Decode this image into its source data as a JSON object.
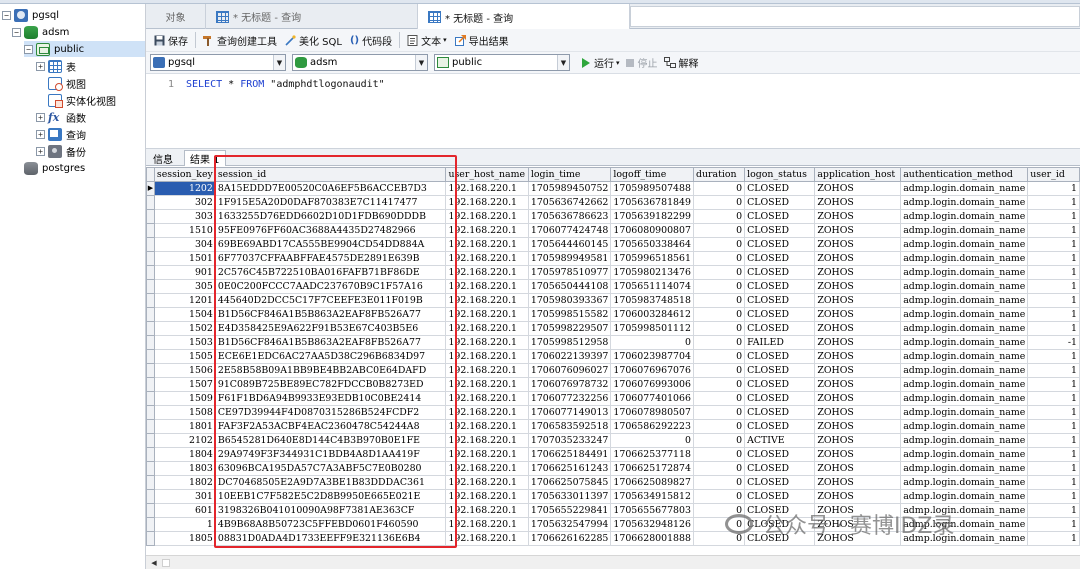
{
  "tree": {
    "connection": "pgsql",
    "database": "adsm",
    "schema": "public",
    "items": [
      "表",
      "视图",
      "实体化视图",
      "函数",
      "查询",
      "备份"
    ],
    "other_database": "postgres"
  },
  "tabs": {
    "objects": "对象",
    "tab1": "* 无标题 - 查询",
    "tab2": "* 无标题 - 查询"
  },
  "toolbar": {
    "save": "保存",
    "query_builder": "查询创建工具",
    "beautify": "美化 SQL",
    "code_snippet": "代码段",
    "text": "文本",
    "export": "导出结果"
  },
  "conn": {
    "connection": "pgsql",
    "database": "adsm",
    "schema": "public",
    "run": "运行",
    "stop": "停止",
    "explain": "解释"
  },
  "editor": {
    "line": "1",
    "kw_select": "SELECT",
    "star": " * ",
    "kw_from": "FROM",
    "table": " \"admphdtlogonaudit\""
  },
  "result_tabs": {
    "info": "信息",
    "result": "结果 1"
  },
  "grid": {
    "columns": [
      "session_key",
      "session_id",
      "user_host_name",
      "login_time",
      "logoff_time",
      "duration",
      "logon_status",
      "application_host",
      "authentication_method",
      "user_id"
    ],
    "rows": [
      [
        "1202",
        "8A15EDDD7E00520C0A6EF5B6ACCEB7D3",
        "192.168.220.1",
        "1705989450752",
        "1705989507488",
        "0",
        "CLOSED",
        "ZOHOS",
        "admp.login.domain_name",
        "1"
      ],
      [
        "302",
        "1F915E5A20D0DAF870383E7C11417477",
        "192.168.220.1",
        "1705636742662",
        "1705636781849",
        "0",
        "CLOSED",
        "ZOHOS",
        "admp.login.domain_name",
        "1"
      ],
      [
        "303",
        "1633255D76EDD6602D10D1FDB690DDDB",
        "192.168.220.1",
        "1705636786623",
        "1705639182299",
        "0",
        "CLOSED",
        "ZOHOS",
        "admp.login.domain_name",
        "1"
      ],
      [
        "1510",
        "95FE0976FF60AC3688A4435D27482966",
        "192.168.220.1",
        "1706077424748",
        "1706080900807",
        "0",
        "CLOSED",
        "ZOHOS",
        "admp.login.domain_name",
        "1"
      ],
      [
        "304",
        "69BE69ABD17CA555BE9904CD54DD884A",
        "192.168.220.1",
        "1705644460145",
        "1705650338464",
        "0",
        "CLOSED",
        "ZOHOS",
        "admp.login.domain_name",
        "1"
      ],
      [
        "1501",
        "6F77037CFFAABFFAE4575DE2891E639B",
        "192.168.220.1",
        "1705989949581",
        "1705996518561",
        "0",
        "CLOSED",
        "ZOHOS",
        "admp.login.domain_name",
        "1"
      ],
      [
        "901",
        "2C576C45B722510BA016FAFB71BF86DE",
        "192.168.220.1",
        "1705978510977",
        "1705980213476",
        "0",
        "CLOSED",
        "ZOHOS",
        "admp.login.domain_name",
        "1"
      ],
      [
        "305",
        "0E0C200FCCC7AADC237670B9C1F57A16",
        "192.168.220.1",
        "1705650444108",
        "1705651114074",
        "0",
        "CLOSED",
        "ZOHOS",
        "admp.login.domain_name",
        "1"
      ],
      [
        "1201",
        "445640D2DCC5C17F7CEEFE3E011F019B",
        "192.168.220.1",
        "1705980393367",
        "1705983748518",
        "0",
        "CLOSED",
        "ZOHOS",
        "admp.login.domain_name",
        "1"
      ],
      [
        "1504",
        "B1D56CF846A1B5B863A2EAF8FB526A77",
        "192.168.220.1",
        "1705998515582",
        "1706003284612",
        "0",
        "CLOSED",
        "ZOHOS",
        "admp.login.domain_name",
        "1"
      ],
      [
        "1502",
        "E4D358425E9A622F91B53E67C403B5E6",
        "192.168.220.1",
        "1705998229507",
        "1705998501112",
        "0",
        "CLOSED",
        "ZOHOS",
        "admp.login.domain_name",
        "1"
      ],
      [
        "1503",
        "B1D56CF846A1B5B863A2EAF8FB526A77",
        "192.168.220.1",
        "1705998512958",
        "0",
        "0",
        "FAILED",
        "ZOHOS",
        "admp.login.domain_name",
        "-1"
      ],
      [
        "1505",
        "ECE6E1EDC6AC27AA5D38C296B6834D97",
        "192.168.220.1",
        "1706022139397",
        "1706023987704",
        "0",
        "CLOSED",
        "ZOHOS",
        "admp.login.domain_name",
        "1"
      ],
      [
        "1506",
        "2E58B58B09A1BB9BE4BB2ABC0E64DAFD",
        "192.168.220.1",
        "1706076096027",
        "1706076967076",
        "0",
        "CLOSED",
        "ZOHOS",
        "admp.login.domain_name",
        "1"
      ],
      [
        "1507",
        "91C089B725BE89EC782FDCCB0B8273ED",
        "192.168.220.1",
        "1706076978732",
        "1706076993006",
        "0",
        "CLOSED",
        "ZOHOS",
        "admp.login.domain_name",
        "1"
      ],
      [
        "1509",
        "F61F1BD6A94B9933E93EDB10C0BE2414",
        "192.168.220.1",
        "1706077232256",
        "1706077401066",
        "0",
        "CLOSED",
        "ZOHOS",
        "admp.login.domain_name",
        "1"
      ],
      [
        "1508",
        "CE97D39944F4D0870315286B524FCDF2",
        "192.168.220.1",
        "1706077149013",
        "1706078980507",
        "0",
        "CLOSED",
        "ZOHOS",
        "admp.login.domain_name",
        "1"
      ],
      [
        "1801",
        "FAF3F2A53ACBF4EAC2360478C54244A8",
        "192.168.220.1",
        "1706583592518",
        "1706586292223",
        "0",
        "CLOSED",
        "ZOHOS",
        "admp.login.domain_name",
        "1"
      ],
      [
        "2102",
        "B6545281D640E8D144C4B3B970B0E1FE",
        "192.168.220.1",
        "1707035233247",
        "0",
        "0",
        "ACTIVE",
        "ZOHOS",
        "admp.login.domain_name",
        "1"
      ],
      [
        "1804",
        "29A9749F3F344931C1BDB4A8D1AA419F",
        "192.168.220.1",
        "1706625184491",
        "1706625377118",
        "0",
        "CLOSED",
        "ZOHOS",
        "admp.login.domain_name",
        "1"
      ],
      [
        "1803",
        "63096BCA195DA57C7A3ABF5C7E0B0280",
        "192.168.220.1",
        "1706625161243",
        "1706625172874",
        "0",
        "CLOSED",
        "ZOHOS",
        "admp.login.domain_name",
        "1"
      ],
      [
        "1802",
        "DC70468505E2A9D7A3BE1B83DDDAC361",
        "192.168.220.1",
        "1706625075845",
        "1706625089827",
        "0",
        "CLOSED",
        "ZOHOS",
        "admp.login.domain_name",
        "1"
      ],
      [
        "301",
        "10EEB1C7F582E5C2D8B9950E665E021E",
        "192.168.220.1",
        "1705633011397",
        "1705634915812",
        "0",
        "CLOSED",
        "ZOHOS",
        "admp.login.domain_name",
        "1"
      ],
      [
        "601",
        "3198326B041010090A98F7381AE363CF",
        "192.168.220.1",
        "1705655229841",
        "1705655677803",
        "0",
        "CLOSED",
        "ZOHOS",
        "admp.login.domain_name",
        "1"
      ],
      [
        "1",
        "4B9B68A8B50723C5FFEBD0601F460590",
        "192.168.220.1",
        "1705632547994",
        "1705632948126",
        "0",
        "CLOSED",
        "ZOHOS",
        "admp.login.domain_name",
        "1"
      ],
      [
        "1805",
        "08831D0ADA4D1733EEFF9E321136E6B4",
        "192.168.220.1",
        "1706626162285",
        "1706628001888",
        "0",
        "CLOSED",
        "ZOHOS",
        "admp.login.domain_name",
        "1"
      ]
    ]
  },
  "watermark": "公众号 · 赛博IDZ录"
}
